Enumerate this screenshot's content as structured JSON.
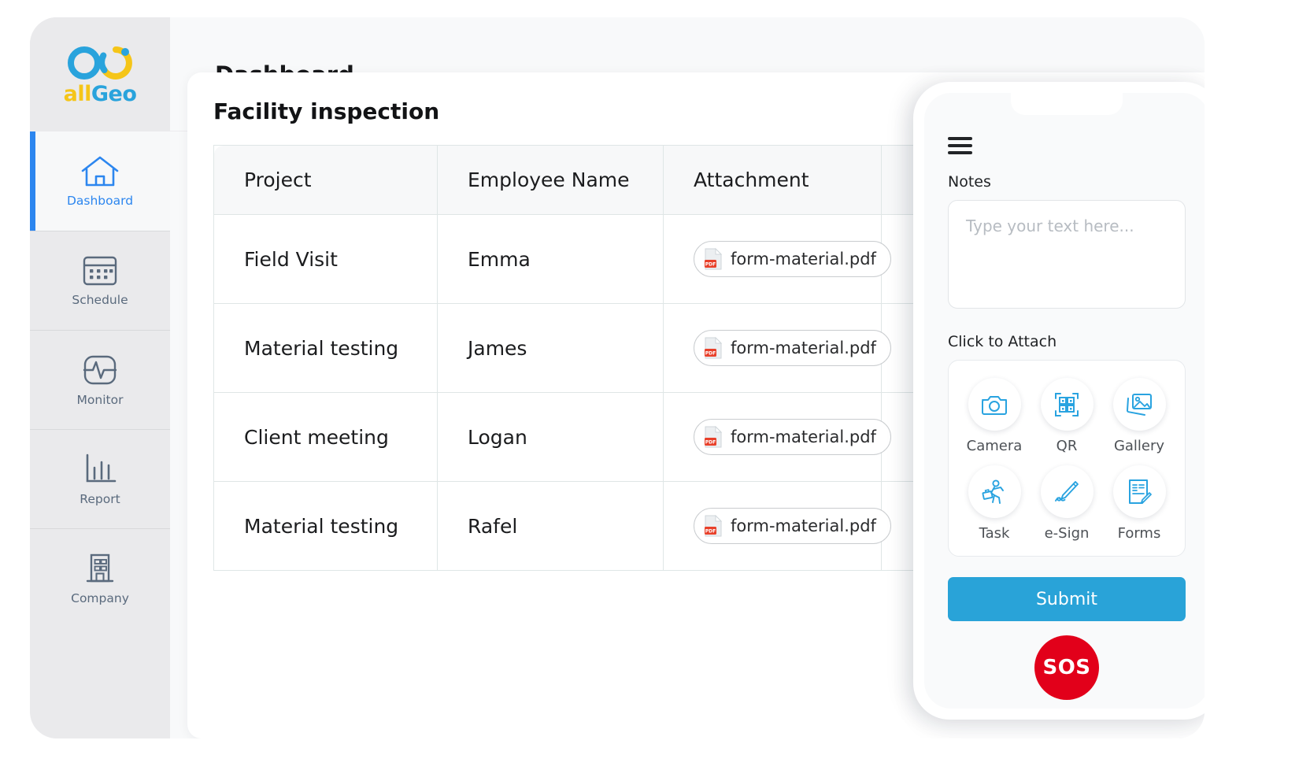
{
  "brand": {
    "logo_icon": "allgeo-infinity-logo",
    "name_part1": "all",
    "name_part2": "Geo",
    "color_yellow": "#f5c518",
    "color_blue": "#29a3dc"
  },
  "sidebar": {
    "items": [
      {
        "label": "Dashboard",
        "icon": "home-icon",
        "active": true
      },
      {
        "label": "Schedule",
        "icon": "calendar-icon",
        "active": false
      },
      {
        "label": "Monitor",
        "icon": "activity-monitor-icon",
        "active": false
      },
      {
        "label": "Report",
        "icon": "bar-chart-icon",
        "active": false
      },
      {
        "label": "Company",
        "icon": "building-icon",
        "active": false
      }
    ],
    "active_color": "#2c86ef",
    "inactive_color": "#5a6a7d"
  },
  "header": {
    "title": "Dashboard"
  },
  "card": {
    "title": "Facility inspection"
  },
  "table": {
    "columns": [
      "Project",
      "Employee Name",
      "Attachment",
      ""
    ],
    "rows": [
      {
        "project": "Field Visit",
        "employee": "Emma",
        "attachment": "form-material.pdf",
        "attachment_icon": "pdf-file-icon"
      },
      {
        "project": "Material testing",
        "employee": "James",
        "attachment": "form-material.pdf",
        "attachment_icon": "pdf-file-icon"
      },
      {
        "project": "Client meeting",
        "employee": "Logan",
        "attachment": "form-material.pdf",
        "attachment_icon": "pdf-file-icon"
      },
      {
        "project": "Material testing",
        "employee": "Rafel",
        "attachment": "form-material.pdf",
        "attachment_icon": "pdf-file-icon"
      }
    ]
  },
  "phone": {
    "menu_icon": "hamburger-menu-icon",
    "notes_label": "Notes",
    "notes_value": "",
    "notes_placeholder": "Type your text here...",
    "attach_label": "Click to Attach",
    "attach_options": [
      {
        "label": "Camera",
        "icon": "camera-icon"
      },
      {
        "label": "QR",
        "icon": "qr-code-icon"
      },
      {
        "label": "Gallery",
        "icon": "gallery-image-icon"
      },
      {
        "label": "Task",
        "icon": "worker-task-icon"
      },
      {
        "label": "e-Sign",
        "icon": "pen-signature-icon"
      },
      {
        "label": "Forms",
        "icon": "form-document-icon"
      }
    ],
    "submit_label": "Submit",
    "sos_label": "SOS",
    "submit_color": "#29a3d8",
    "sos_color": "#e2001a",
    "icon_color": "#29a3e0"
  }
}
